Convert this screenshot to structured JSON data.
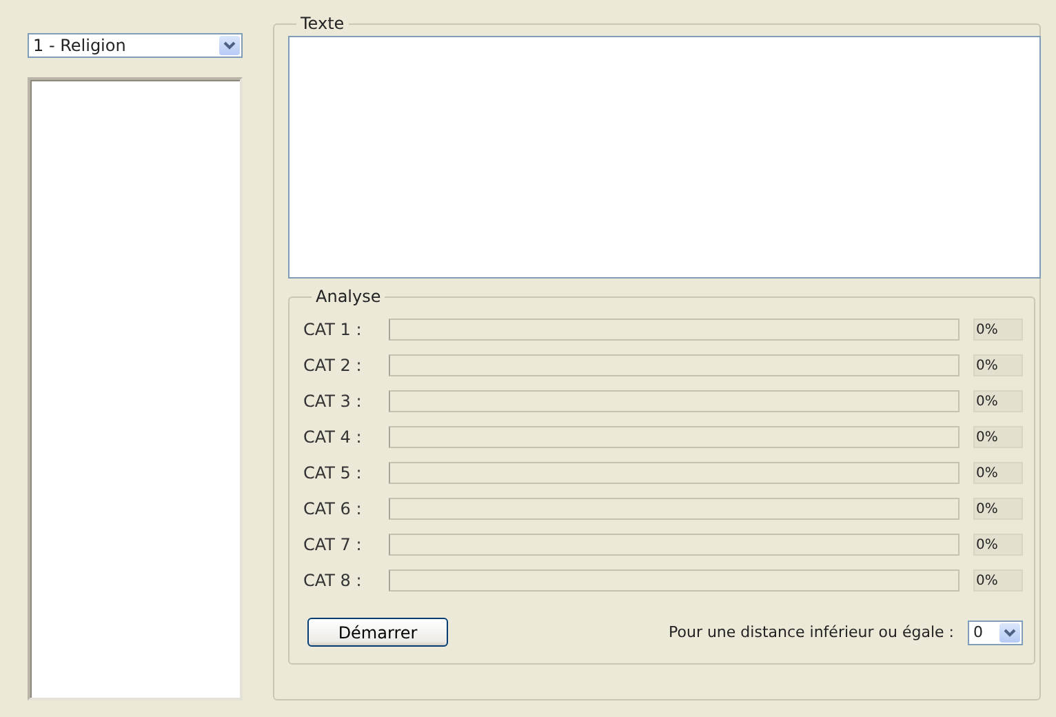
{
  "category_select": {
    "value": "1 - Religion"
  },
  "texte_group": {
    "title": "Texte"
  },
  "analyse_group": {
    "title": "Analyse",
    "categories": [
      {
        "label": "CAT 1 :",
        "level": 0,
        "reading": "0%"
      },
      {
        "label": "CAT 2 :",
        "level": 0,
        "reading": "0%"
      },
      {
        "label": "CAT 3 :",
        "level": 0,
        "reading": "0%"
      },
      {
        "label": "CAT 4 :",
        "level": 0,
        "reading": "0%"
      },
      {
        "label": "CAT 5 :",
        "level": 0,
        "reading": "0%"
      },
      {
        "label": "CAT 6 :",
        "level": 0,
        "reading": "0%"
      },
      {
        "label": "CAT 7 :",
        "level": 0,
        "reading": "0%"
      },
      {
        "label": "CAT 8 :",
        "level": 0,
        "reading": "0%"
      }
    ],
    "start_button": "Démarrer",
    "distance_label": "Pour une distance inférieur ou égale :",
    "distance_select": {
      "value": "0"
    }
  }
}
